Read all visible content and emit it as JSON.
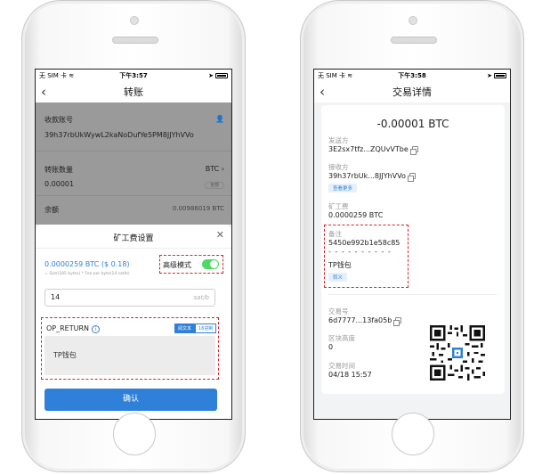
{
  "status_left": [
    "无 SIM 卡",
    "≋"
  ],
  "transfer": {
    "time": "下午3:57",
    "title": "转账",
    "payee_label": "收款账号",
    "payee_address": "39h37rbUkWywL2kaNoDufYe5PM8JJYhVVo",
    "amount_label": "转账数量",
    "currency": "BTC",
    "amount": "0.00001",
    "all_label": "全部",
    "balance_label": "余额",
    "balance_value": "0.00986019 BTC",
    "sheet_title": "矿工费设置",
    "fee_text": "0.0000259 BTC ($ 0.18)",
    "fee_hint": "= Size(185 bytes) * Fee per byte(14 sat/b)",
    "advanced_label": "高级模式",
    "advanced_on": true,
    "fee_input": "14",
    "fee_unit": "sat/b",
    "op_return_label": "OP_RETURN",
    "seg_text": "阅文本",
    "seg_hex": "16进制",
    "op_return_value": "TP钱包",
    "confirm_label": "确认"
  },
  "detail": {
    "time": "下午3:58",
    "title": "交易详情",
    "amount": "-0.00001 BTC",
    "from_label": "发送方",
    "from_value": "3E2sx7tfz...ZQUvVTbe",
    "to_label": "接收方",
    "to_value": "39h37rbUk...8JJYhVVo",
    "see_more": "查看更多",
    "fee_label": "矿工费",
    "fee_value": "0.0000259 BTC",
    "memo_label": "备注",
    "memo_hex": "5450e992b1e58c85",
    "memo_divider": "- - - - - - - - - -",
    "memo_text": "TP钱包",
    "escape_label": "转义",
    "txid_label": "交易号",
    "txid_value": "6d7777...13fa05b",
    "height_label": "区块高度",
    "height_value": "0",
    "tx_time_label": "交易时间",
    "tx_time_value": "04/18 15:57"
  },
  "colors": {
    "accent": "#2f80d8",
    "toggle": "#4cd964",
    "highlight": "#d6262b"
  }
}
